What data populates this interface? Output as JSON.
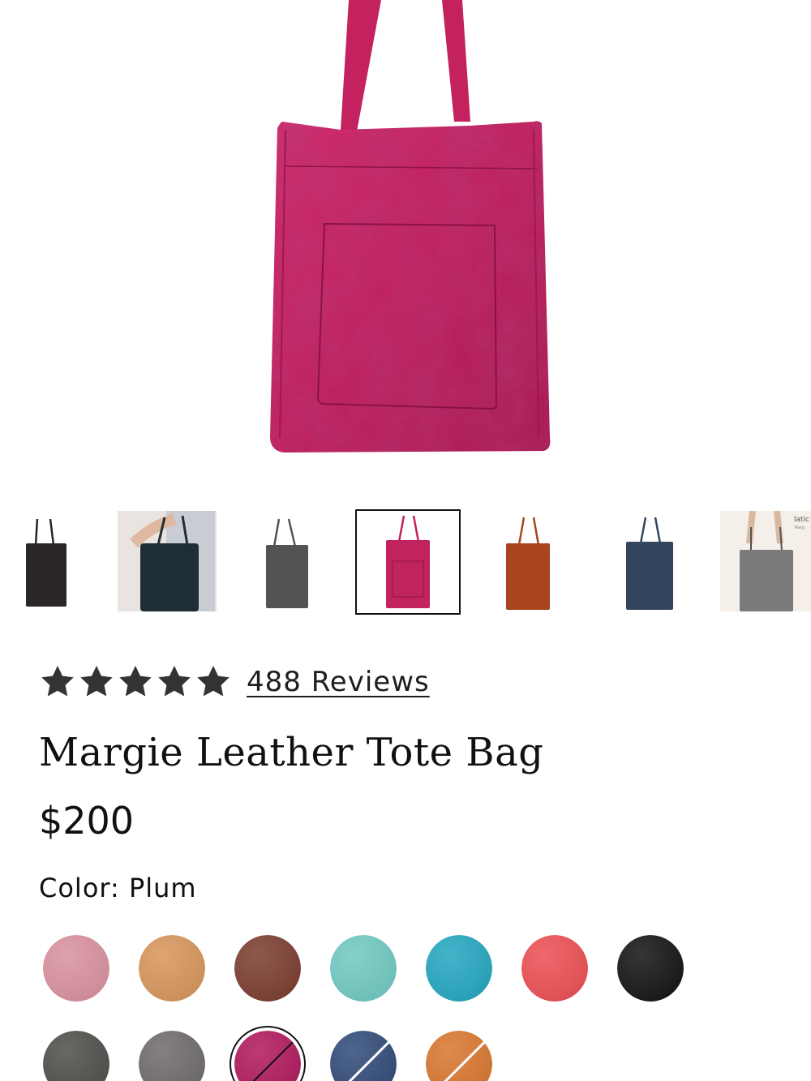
{
  "product": {
    "title": "Margie Leather Tote Bag",
    "price": "$200",
    "color_label": "Color:",
    "color_value": "Plum",
    "rating": {
      "stars": 5,
      "reviews_text": "488 Reviews"
    }
  },
  "hero_image": {
    "icon": "plum-tote-bag-image",
    "color": "#c02060"
  },
  "thumbnails": [
    {
      "name": "black",
      "color": "#2a2626",
      "kind": "bag",
      "selected": false
    },
    {
      "name": "navy-model",
      "color": "#1f2d36",
      "kind": "model",
      "selected": false
    },
    {
      "name": "gray",
      "color": "#555254",
      "kind": "bag",
      "selected": false
    },
    {
      "name": "plum",
      "color": "#c0235e",
      "kind": "bag",
      "selected": true
    },
    {
      "name": "rust",
      "color": "#a84420",
      "kind": "bag",
      "selected": false
    },
    {
      "name": "navy",
      "color": "#34465e",
      "kind": "bag",
      "selected": false
    },
    {
      "name": "gray-model",
      "color": "#7a7a7a",
      "kind": "model",
      "selected": false,
      "caption": "latic",
      "caption2": "Marg"
    }
  ],
  "swatches": [
    {
      "name": "pink",
      "color": "#d8909e",
      "available": true
    },
    {
      "name": "tan",
      "color": "#d7955a",
      "available": true
    },
    {
      "name": "brown",
      "color": "#7a3c2e",
      "available": true
    },
    {
      "name": "turquoise",
      "color": "#6fc9c1",
      "available": true
    },
    {
      "name": "teal",
      "color": "#23a6c0",
      "available": true
    },
    {
      "name": "coral",
      "color": "#ec4e52",
      "available": true
    },
    {
      "name": "black",
      "color": "#121212",
      "available": true
    },
    {
      "name": "dark-gray",
      "color": "#4e4d4a",
      "available": true
    },
    {
      "name": "gray",
      "color": "#6e6a6c",
      "available": true
    },
    {
      "name": "plum",
      "color": "#b0185c",
      "available": false,
      "selected": true
    },
    {
      "name": "navy",
      "color": "#2f4a78",
      "available": false
    },
    {
      "name": "orange",
      "color": "#d8762e",
      "available": false
    }
  ]
}
